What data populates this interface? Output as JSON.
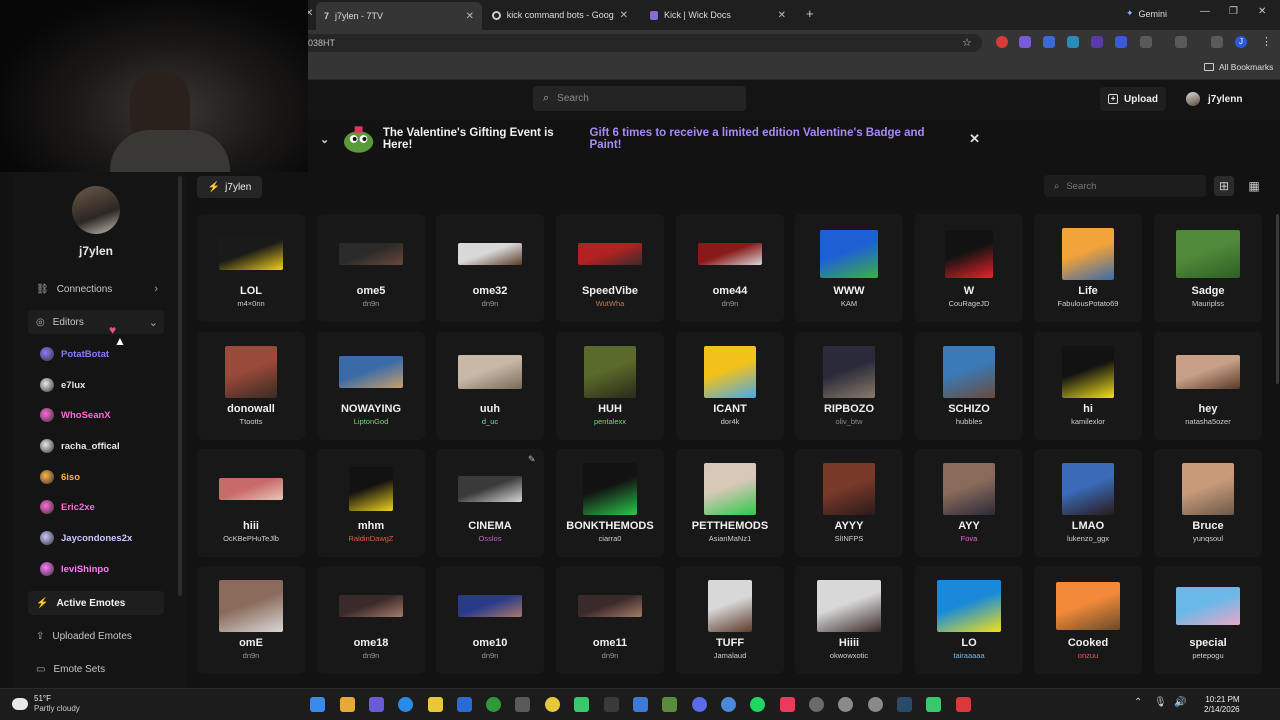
{
  "browser": {
    "tabs": [
      {
        "label": "j7ylen - 7TV",
        "active": true
      },
      {
        "label": "kick command bots - Google S",
        "active": false
      },
      {
        "label": "Kick | Wick Docs",
        "active": false
      }
    ],
    "address_fragment": "038HT",
    "gemini_label": "Gemini",
    "bookmarks_label": "All Bookmarks",
    "profile_initial": "J"
  },
  "topbar": {
    "search_placeholder": "Search",
    "upload_label": "Upload",
    "username": "j7ylenn"
  },
  "banner": {
    "title": "The Valentine's Gifting Event is Here!",
    "subtitle": "Gift 6 times to receive a limited edition Valentine's Badge and Paint!",
    "accent_color": "#a78bfa"
  },
  "sidebar": {
    "profile_name": "j7ylen",
    "connections_label": "Connections",
    "editors_label": "Editors",
    "editors": [
      {
        "name": "PotatBotat",
        "color": "#8a7bff"
      },
      {
        "name": "e7lux",
        "color": "#e8e8e8"
      },
      {
        "name": "WhoSeanX",
        "color": "#ff6ad5"
      },
      {
        "name": "racha_offical",
        "color": "#e8e8e8"
      },
      {
        "name": "6iso",
        "color": "#ffb347"
      },
      {
        "name": "Eric2xe",
        "color": "#ff6ad5"
      },
      {
        "name": "Jaycondones2x",
        "color": "#c8c8ff"
      },
      {
        "name": "leviShinpo",
        "color": "#ff7bff"
      }
    ],
    "nav": [
      {
        "label": "Active Emotes",
        "active": true
      },
      {
        "label": "Uploaded Emotes",
        "active": false
      },
      {
        "label": "Emote Sets",
        "active": false
      }
    ]
  },
  "content": {
    "set_chip": "j7ylen",
    "search_placeholder": "Search"
  },
  "emotes": [
    {
      "name": "LOL",
      "owner": "m4×0nn",
      "owner_color": "#cfcfcf",
      "colors": [
        "#1a1a1a",
        "#f2d21b"
      ]
    },
    {
      "name": "ome5",
      "owner": "dn9n",
      "owner_color": "#9a9a9a",
      "colors": [
        "#2a2a2a",
        "#6a4a3a"
      ]
    },
    {
      "name": "ome32",
      "owner": "dn9n",
      "owner_color": "#9a9a9a",
      "colors": [
        "#d8d8d8",
        "#5a3a2a"
      ]
    },
    {
      "name": "SpeedVibe",
      "owner": "WutWha",
      "owner_color": "#c0785a",
      "colors": [
        "#b22222",
        "#3a2a2a"
      ]
    },
    {
      "name": "ome44",
      "owner": "dn9n",
      "owner_color": "#9a9a9a",
      "colors": [
        "#8a1a1a",
        "#d8d8d8"
      ]
    },
    {
      "name": "WWW",
      "owner": "KAM",
      "owner_color": "#cfcfcf",
      "colors": [
        "#1f5fd6",
        "#3cb043"
      ]
    },
    {
      "name": "W",
      "owner": "CouRageJD",
      "owner_color": "#cfcfcf",
      "colors": [
        "#121212",
        "#e8232a"
      ]
    },
    {
      "name": "Life",
      "owner": "FabulousPotato69",
      "owner_color": "#cfcfcf",
      "colors": [
        "#f2a33a",
        "#3a6aa8"
      ]
    },
    {
      "name": "Sadge",
      "owner": "Mauriplss",
      "owner_color": "#cfcfcf",
      "colors": [
        "#4f8a3a",
        "#2e5e24"
      ]
    },
    {
      "name": "donowall",
      "owner": "Ttootts",
      "owner_color": "#cfcfcf",
      "colors": [
        "#9a4a3a",
        "#3a2a22"
      ]
    },
    {
      "name": "NOWAYING",
      "owner": "LiptonGod",
      "owner_color": "#7ad87a",
      "colors": [
        "#3a6aa8",
        "#c8a06a"
      ]
    },
    {
      "name": "uuh",
      "owner": "d_uc",
      "owner_color": "#7ad8c8",
      "colors": [
        "#c8b8a8",
        "#7a6a5a"
      ]
    },
    {
      "name": "HUH",
      "owner": "pentalexx",
      "owner_color": "#7ad87a",
      "colors": [
        "#5a6a2a",
        "#2a2a1a"
      ]
    },
    {
      "name": "ICANT",
      "owner": "dor4k",
      "owner_color": "#cfcfcf",
      "colors": [
        "#f2c21b",
        "#4aa8e8"
      ]
    },
    {
      "name": "RIPBOZO",
      "owner": "oliv_btw",
      "owner_color": "#8a8a8a",
      "colors": [
        "#2a2a3a",
        "#8a7a6a"
      ]
    },
    {
      "name": "SCHIZO",
      "owner": "hubbles",
      "owner_color": "#cfcfcf",
      "colors": [
        "#3a7ab8",
        "#6a4a3a"
      ]
    },
    {
      "name": "hi",
      "owner": "kamilexlor",
      "owner_color": "#cfcfcf",
      "colors": [
        "#121212",
        "#f2e21b"
      ]
    },
    {
      "name": "hey",
      "owner": "natasha5ozer",
      "owner_color": "#cfcfcf",
      "colors": [
        "#c8a088",
        "#5a3a2a"
      ]
    },
    {
      "name": "hiii",
      "owner": "OcKBePHuTeJlb",
      "owner_color": "#cfcfcf",
      "colors": [
        "#c86a6a",
        "#e8c8b8"
      ]
    },
    {
      "name": "mhm",
      "owner": "RaldinDawgZ",
      "owner_color": "#e85a3a",
      "colors": [
        "#121212",
        "#f2d21b"
      ]
    },
    {
      "name": "CINEMA",
      "owner": "Osslos",
      "owner_color": "#b86ab8",
      "colors": [
        "#3a3a3a",
        "#d8d8d8"
      ]
    },
    {
      "name": "BONKTHEMODS",
      "owner": "ciarra0",
      "owner_color": "#cfcfcf",
      "colors": [
        "#121212",
        "#2ec84a"
      ]
    },
    {
      "name": "PETTHEMODS",
      "owner": "AsianMaNz1",
      "owner_color": "#cfcfcf",
      "colors": [
        "#d8c8b8",
        "#2ec84a"
      ]
    },
    {
      "name": "AYYY",
      "owner": "SlINFPS",
      "owner_color": "#cfcfcf",
      "colors": [
        "#7a3a2a",
        "#2a1a1a"
      ]
    },
    {
      "name": "AYY",
      "owner": "Fova",
      "owner_color": "#e86ad8",
      "colors": [
        "#8a6a5a",
        "#2a2a3a"
      ]
    },
    {
      "name": "LMAO",
      "owner": "lukenzo_ggx",
      "owner_color": "#cfcfcf",
      "colors": [
        "#3a6ab8",
        "#2a1a1a"
      ]
    },
    {
      "name": "Bruce",
      "owner": "yunqsoul",
      "owner_color": "#cfcfcf",
      "colors": [
        "#c89a7a",
        "#6a5a4a"
      ]
    },
    {
      "name": "omE",
      "owner": "dn9n",
      "owner_color": "#9a9a9a",
      "colors": [
        "#8a6a5a",
        "#d8d8d8"
      ]
    },
    {
      "name": "ome18",
      "owner": "dn9n",
      "owner_color": "#9a9a9a",
      "colors": [
        "#3a2a2a",
        "#a87a6a"
      ]
    },
    {
      "name": "ome10",
      "owner": "dn9n",
      "owner_color": "#9a9a9a",
      "colors": [
        "#2a3a8a",
        "#a87a6a"
      ]
    },
    {
      "name": "ome11",
      "owner": "dn9n",
      "owner_color": "#9a9a9a",
      "colors": [
        "#3a2a2a",
        "#a87a6a"
      ]
    },
    {
      "name": "TUFF",
      "owner": "Jamalaud",
      "owner_color": "#cfcfcf",
      "colors": [
        "#d8d8d8",
        "#5a3a2a"
      ]
    },
    {
      "name": "Hiiii",
      "owner": "okwowxotic",
      "owner_color": "#cfcfcf",
      "colors": [
        "#d8d8d8",
        "#3a2a2a"
      ]
    },
    {
      "name": "LO",
      "owner": "tairaaaaa",
      "owner_color": "#7ab8e8",
      "colors": [
        "#1a8ad8",
        "#f2e21b"
      ]
    },
    {
      "name": "Cooked",
      "owner": "onzuu",
      "owner_color": "#e85a5a",
      "colors": [
        "#f28a3a",
        "#6a4a2a"
      ]
    },
    {
      "name": "special",
      "owner": "petepogu",
      "owner_color": "#cfcfcf",
      "colors": [
        "#6ab8e8",
        "#e8a8c8"
      ]
    }
  ],
  "taskbar": {
    "weather_temp": "51°F",
    "weather_desc": "Partly cloudy",
    "time": "10:21 PM",
    "date": "2/14/2026"
  }
}
